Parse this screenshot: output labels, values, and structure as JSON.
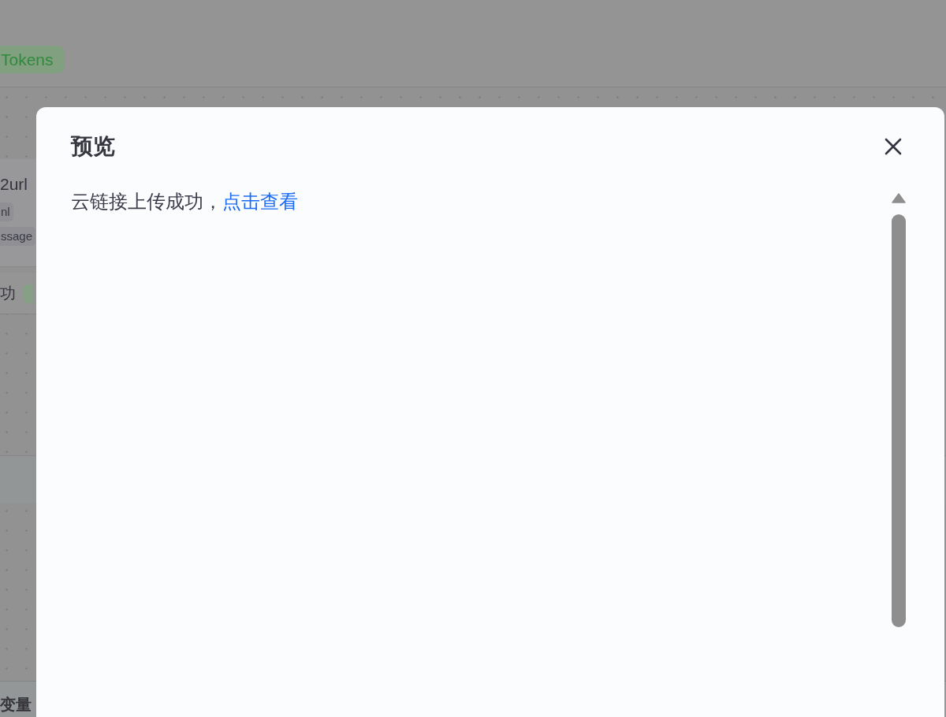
{
  "background": {
    "header_badge": "Tokens",
    "node": {
      "title": "2url",
      "tags": [
        "nl",
        "ssage"
      ]
    },
    "status": {
      "label": "功"
    },
    "footer_label": "变量"
  },
  "dialog": {
    "title": "预览",
    "message": "云链接上传成功，",
    "link": "点击查看"
  }
}
